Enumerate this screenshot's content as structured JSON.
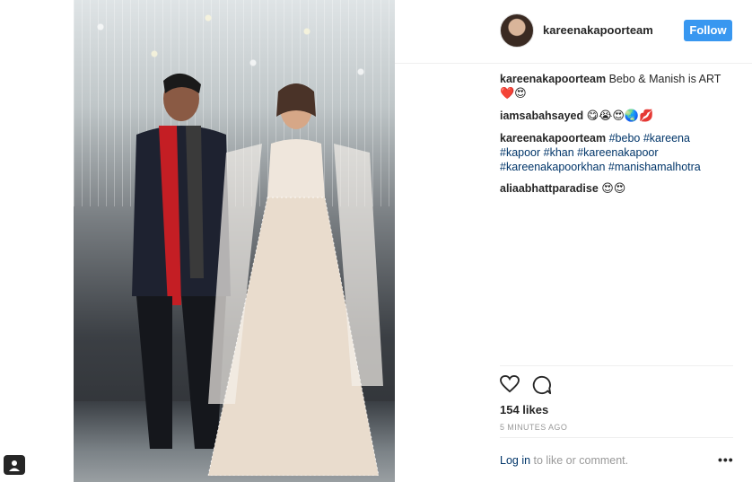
{
  "post": {
    "username": "kareenakapoorteam",
    "follow_label": "Follow",
    "likes": "154 likes",
    "timestamp": "5 MINUTES AGO",
    "login_link": "Log in",
    "login_suffix": " to like or comment.",
    "more_label": "•••"
  },
  "comments": [
    {
      "user": "kareenakapoorteam",
      "text": " Bebo & Manish is ART",
      "emoji": "❤️😍"
    },
    {
      "user": "iamsabahsayed",
      "text": " ",
      "emoji": "😋😭😍🌏💋"
    },
    {
      "user": "kareenakapoorteam",
      "tags": "#bebo #kareena #kapoor #khan #kareenakapoor #kareenakapoorkhan #manishamalhotra"
    },
    {
      "user": "aliaabhattparadise",
      "text": " ",
      "emoji": "😍😍"
    }
  ],
  "icons": {
    "heart": "heart-icon",
    "comment": "comment-icon",
    "profile": "profile-icon"
  },
  "colors": {
    "follow_bg": "#3897f0",
    "link": "#003569",
    "muted": "#999999"
  }
}
